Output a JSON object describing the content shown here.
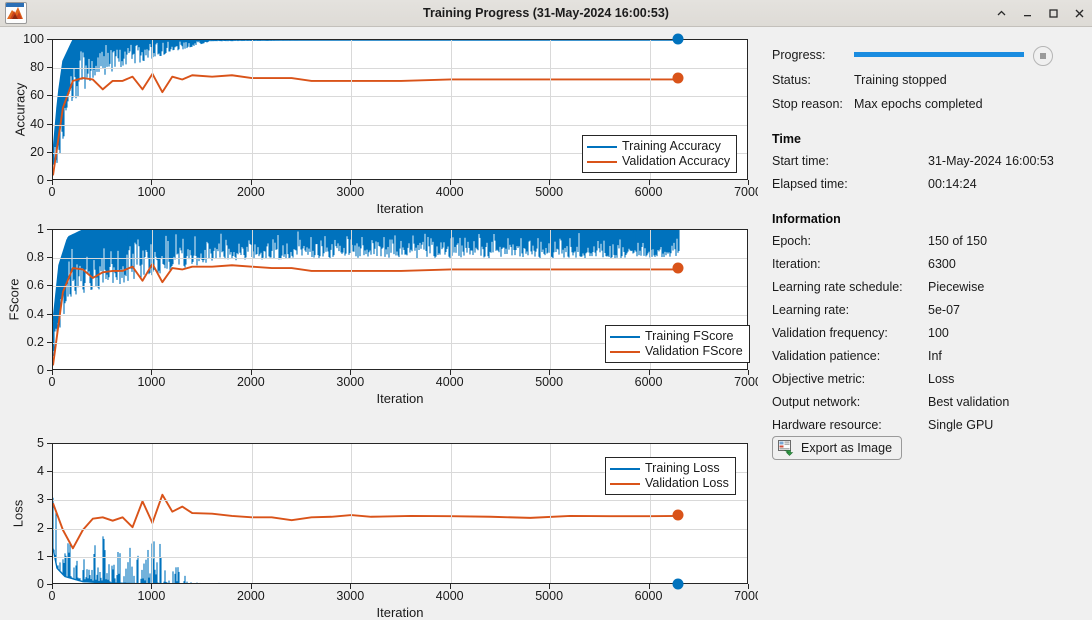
{
  "window": {
    "title": "Training Progress (31-May-2024 16:00:53)",
    "app_icon": "matlab-icon",
    "buttons": {
      "collapse": "^",
      "minimize": "—",
      "maximize": "▢",
      "close": "✕"
    }
  },
  "sidebar": {
    "progress_label": "Progress:",
    "progress_percent": 100,
    "stop_button": "stop-button",
    "status_label": "Status:",
    "status_value": "Training stopped",
    "stop_reason_label": "Stop reason:",
    "stop_reason_value": "Max epochs completed",
    "time_heading": "Time",
    "start_time_label": "Start time:",
    "start_time_value": "31-May-2024 16:00:53",
    "elapsed_time_label": "Elapsed time:",
    "elapsed_time_value": "00:14:24",
    "information_heading": "Information",
    "info": [
      {
        "label": "Epoch:",
        "value": "150 of 150"
      },
      {
        "label": "Iteration:",
        "value": "6300"
      },
      {
        "label": "Learning rate schedule:",
        "value": "Piecewise"
      },
      {
        "label": "Learning rate:",
        "value": "5e-07"
      },
      {
        "label": "Validation frequency:",
        "value": "100"
      },
      {
        "label": "Validation patience:",
        "value": "Inf"
      },
      {
        "label": "Objective metric:",
        "value": "Loss"
      },
      {
        "label": "Output network:",
        "value": "Best validation"
      },
      {
        "label": "Hardware resource:",
        "value": "Single GPU"
      }
    ],
    "export_button": "Export as Image"
  },
  "colors": {
    "training": "#0072BD",
    "validation": "#D95319",
    "progress": "#1a8ce0",
    "grid": "#d9d9d9",
    "axis": "#262626",
    "window_bg": "#f0f0f0"
  },
  "chart_data": [
    {
      "type": "line",
      "title": "",
      "id": "accuracy",
      "xlabel": "Iteration",
      "ylabel": "Accuracy",
      "xlim": [
        0,
        7000
      ],
      "ylim": [
        0,
        100
      ],
      "xticks": [
        0,
        1000,
        2000,
        3000,
        4000,
        5000,
        6000,
        7000
      ],
      "yticks": [
        0,
        20,
        40,
        60,
        80,
        100
      ],
      "grid": true,
      "legend_position": "inside-lower-right",
      "legend": [
        "Training Accuracy",
        "Validation Accuracy"
      ],
      "series": [
        {
          "name": "Training Accuracy",
          "color": "#0072BD",
          "final_value": 100,
          "final_x": 6300,
          "marker_end": true,
          "description": "Noisy mini-batch accuracy; rises from ~5 to ~100 within 300 iterations, saturates at 100 with downward spikes decaying to zero after ~1300",
          "envelope": [
            {
              "x": 0,
              "low": 5,
              "high": 20
            },
            {
              "x": 50,
              "low": 10,
              "high": 60
            },
            {
              "x": 100,
              "low": 25,
              "high": 85
            },
            {
              "x": 200,
              "low": 55,
              "high": 100
            },
            {
              "x": 400,
              "low": 72,
              "high": 100
            },
            {
              "x": 700,
              "low": 80,
              "high": 100
            },
            {
              "x": 1000,
              "low": 86,
              "high": 100
            },
            {
              "x": 1300,
              "low": 93,
              "high": 100
            },
            {
              "x": 1600,
              "low": 99,
              "high": 100
            },
            {
              "x": 3000,
              "low": 100,
              "high": 100
            },
            {
              "x": 6300,
              "low": 100,
              "high": 100
            }
          ]
        },
        {
          "name": "Validation Accuracy",
          "color": "#D95319",
          "final_value": 72,
          "final_x": 6300,
          "marker_end": true,
          "values": [
            {
              "x": 0,
              "y": 4
            },
            {
              "x": 100,
              "y": 52
            },
            {
              "x": 200,
              "y": 71
            },
            {
              "x": 300,
              "y": 73
            },
            {
              "x": 400,
              "y": 72
            },
            {
              "x": 500,
              "y": 65
            },
            {
              "x": 600,
              "y": 71
            },
            {
              "x": 700,
              "y": 71
            },
            {
              "x": 800,
              "y": 74
            },
            {
              "x": 900,
              "y": 65
            },
            {
              "x": 1000,
              "y": 76
            },
            {
              "x": 1100,
              "y": 63
            },
            {
              "x": 1200,
              "y": 74
            },
            {
              "x": 1300,
              "y": 72
            },
            {
              "x": 1400,
              "y": 75
            },
            {
              "x": 1600,
              "y": 74
            },
            {
              "x": 1800,
              "y": 75
            },
            {
              "x": 2000,
              "y": 73
            },
            {
              "x": 2200,
              "y": 73
            },
            {
              "x": 2400,
              "y": 73
            },
            {
              "x": 2600,
              "y": 71
            },
            {
              "x": 3000,
              "y": 71
            },
            {
              "x": 3500,
              "y": 71
            },
            {
              "x": 4000,
              "y": 72
            },
            {
              "x": 4500,
              "y": 72
            },
            {
              "x": 5000,
              "y": 72
            },
            {
              "x": 5500,
              "y": 72
            },
            {
              "x": 6000,
              "y": 72
            },
            {
              "x": 6300,
              "y": 72
            }
          ]
        }
      ]
    },
    {
      "type": "line",
      "title": "",
      "id": "fscore",
      "xlabel": "Iteration",
      "ylabel": "FScore",
      "xlim": [
        0,
        7000
      ],
      "ylim": [
        0,
        1
      ],
      "xticks": [
        0,
        1000,
        2000,
        3000,
        4000,
        5000,
        6000,
        7000
      ],
      "yticks": [
        0,
        0.2,
        0.4,
        0.6,
        0.8,
        1
      ],
      "grid": true,
      "legend_position": "inside-lower-right",
      "legend": [
        "Training FScore",
        "Validation FScore"
      ],
      "series": [
        {
          "name": "Training FScore",
          "color": "#0072BD",
          "final_value": 1,
          "final_x": 6300,
          "marker_end": false,
          "description": "Dense noise band between ~0.6 and 1.0 across the whole run, occasional dips toward 0.6",
          "envelope": [
            {
              "x": 0,
              "low": 0.02,
              "high": 0.35
            },
            {
              "x": 60,
              "low": 0.2,
              "high": 0.75
            },
            {
              "x": 150,
              "low": 0.45,
              "high": 0.95
            },
            {
              "x": 300,
              "low": 0.55,
              "high": 1.0
            },
            {
              "x": 700,
              "low": 0.62,
              "high": 1.0
            },
            {
              "x": 1200,
              "low": 0.7,
              "high": 1.0
            },
            {
              "x": 1600,
              "low": 0.78,
              "high": 1.0
            },
            {
              "x": 3000,
              "low": 0.8,
              "high": 1.0
            },
            {
              "x": 6300,
              "low": 0.8,
              "high": 1.0
            }
          ]
        },
        {
          "name": "Validation FScore",
          "color": "#D95319",
          "final_value": 0.72,
          "final_x": 6300,
          "marker_end": true,
          "values": [
            {
              "x": 0,
              "y": 0.04
            },
            {
              "x": 100,
              "y": 0.56
            },
            {
              "x": 200,
              "y": 0.73
            },
            {
              "x": 300,
              "y": 0.72
            },
            {
              "x": 400,
              "y": 0.66
            },
            {
              "x": 500,
              "y": 0.7
            },
            {
              "x": 600,
              "y": 0.71
            },
            {
              "x": 700,
              "y": 0.71
            },
            {
              "x": 800,
              "y": 0.74
            },
            {
              "x": 900,
              "y": 0.64
            },
            {
              "x": 1000,
              "y": 0.76
            },
            {
              "x": 1100,
              "y": 0.63
            },
            {
              "x": 1200,
              "y": 0.73
            },
            {
              "x": 1300,
              "y": 0.72
            },
            {
              "x": 1400,
              "y": 0.74
            },
            {
              "x": 1600,
              "y": 0.74
            },
            {
              "x": 1800,
              "y": 0.75
            },
            {
              "x": 2000,
              "y": 0.74
            },
            {
              "x": 2200,
              "y": 0.73
            },
            {
              "x": 2400,
              "y": 0.73
            },
            {
              "x": 2600,
              "y": 0.71
            },
            {
              "x": 3000,
              "y": 0.71
            },
            {
              "x": 3500,
              "y": 0.71
            },
            {
              "x": 4000,
              "y": 0.72
            },
            {
              "x": 4500,
              "y": 0.72
            },
            {
              "x": 5000,
              "y": 0.72
            },
            {
              "x": 5500,
              "y": 0.72
            },
            {
              "x": 6000,
              "y": 0.72
            },
            {
              "x": 6300,
              "y": 0.72
            }
          ]
        }
      ]
    },
    {
      "type": "line",
      "title": "",
      "id": "loss",
      "xlabel": "Iteration",
      "ylabel": "Loss",
      "xlim": [
        0,
        7000
      ],
      "ylim": [
        0,
        5
      ],
      "xticks": [
        0,
        1000,
        2000,
        3000,
        4000,
        5000,
        6000,
        7000
      ],
      "yticks": [
        0,
        1,
        2,
        3,
        4,
        5
      ],
      "grid": true,
      "legend_position": "inside-upper-right",
      "legend": [
        "Training Loss",
        "Validation Loss"
      ],
      "series": [
        {
          "name": "Training Loss",
          "color": "#0072BD",
          "final_value": 0,
          "final_x": 6300,
          "marker_end": true,
          "description": "Spiky mini-batch loss starting near 5, decaying to ~0 by iteration 1300 then flat at 0",
          "envelope": [
            {
              "x": 0,
              "low": 1.3,
              "high": 5.0
            },
            {
              "x": 40,
              "low": 0.6,
              "high": 2.2
            },
            {
              "x": 120,
              "low": 0.3,
              "high": 1.8
            },
            {
              "x": 300,
              "low": 0.12,
              "high": 1.2
            },
            {
              "x": 500,
              "low": 0.08,
              "high": 1.75
            },
            {
              "x": 800,
              "low": 0.05,
              "high": 1.3
            },
            {
              "x": 1000,
              "low": 0.04,
              "high": 1.6
            },
            {
              "x": 1250,
              "low": 0.03,
              "high": 1.25
            },
            {
              "x": 1350,
              "low": 0.0,
              "high": 0.1
            },
            {
              "x": 3000,
              "low": 0.0,
              "high": 0.02
            },
            {
              "x": 6300,
              "low": 0.0,
              "high": 0.02
            }
          ]
        },
        {
          "name": "Validation Loss",
          "color": "#D95319",
          "final_value": 2.45,
          "final_x": 6300,
          "marker_end": true,
          "values": [
            {
              "x": 0,
              "y": 2.9
            },
            {
              "x": 100,
              "y": 1.95
            },
            {
              "x": 200,
              "y": 1.3
            },
            {
              "x": 300,
              "y": 1.95
            },
            {
              "x": 400,
              "y": 2.35
            },
            {
              "x": 500,
              "y": 2.4
            },
            {
              "x": 600,
              "y": 2.28
            },
            {
              "x": 700,
              "y": 2.4
            },
            {
              "x": 800,
              "y": 2.05
            },
            {
              "x": 900,
              "y": 2.97
            },
            {
              "x": 1000,
              "y": 2.2
            },
            {
              "x": 1100,
              "y": 3.2
            },
            {
              "x": 1200,
              "y": 2.6
            },
            {
              "x": 1300,
              "y": 2.78
            },
            {
              "x": 1400,
              "y": 2.55
            },
            {
              "x": 1600,
              "y": 2.53
            },
            {
              "x": 1800,
              "y": 2.45
            },
            {
              "x": 2000,
              "y": 2.4
            },
            {
              "x": 2200,
              "y": 2.4
            },
            {
              "x": 2400,
              "y": 2.3
            },
            {
              "x": 2600,
              "y": 2.4
            },
            {
              "x": 2800,
              "y": 2.42
            },
            {
              "x": 3000,
              "y": 2.48
            },
            {
              "x": 3200,
              "y": 2.42
            },
            {
              "x": 3600,
              "y": 2.45
            },
            {
              "x": 4000,
              "y": 2.44
            },
            {
              "x": 4400,
              "y": 2.42
            },
            {
              "x": 4800,
              "y": 2.38
            },
            {
              "x": 5200,
              "y": 2.45
            },
            {
              "x": 5600,
              "y": 2.44
            },
            {
              "x": 6000,
              "y": 2.44
            },
            {
              "x": 6300,
              "y": 2.45
            }
          ]
        }
      ]
    }
  ]
}
